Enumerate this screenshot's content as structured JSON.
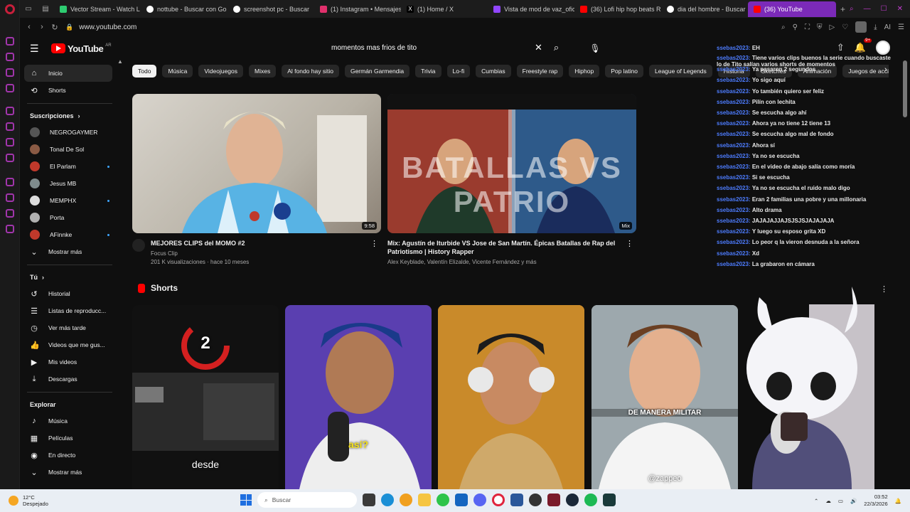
{
  "browser": {
    "tabs": [
      {
        "label": "Vector Stream - Watch L",
        "color": "#2ecc71"
      },
      {
        "label": "nottube - Buscar con Go",
        "color": "#ffffff"
      },
      {
        "label": "screenshot pc - Buscar",
        "color": "#ffffff"
      },
      {
        "label": "(1) Instagram • Mensajes",
        "color": "#e1306c"
      },
      {
        "label": "(1) Home / X",
        "color": "#000000"
      },
      {
        "label": "Vista de mod de vaz_ofic",
        "color": "#9146ff"
      },
      {
        "label": "(36) Lofi hip hop beats R",
        "color": "#ff0000"
      },
      {
        "label": "dia del hombre - Buscar",
        "color": "#ffffff"
      },
      {
        "label": "(36) YouTube",
        "color": "#ff0000"
      }
    ],
    "url": "www.youtube.com",
    "accent": "#7b2ab8"
  },
  "header": {
    "logo_text": "YouTube",
    "logo_region": "AR",
    "search_value": "momentos mas frios de tito",
    "notif_badge": "9+"
  },
  "nav": {
    "main": [
      {
        "label": "Inicio",
        "icon": "home-icon"
      },
      {
        "label": "Shorts",
        "icon": "shorts-icon"
      }
    ],
    "subs_title": "Suscripciones",
    "subs": [
      {
        "label": "NEGROGAYMER",
        "color": "#555555",
        "live": false
      },
      {
        "label": "Tonal De Sol",
        "color": "#8a5a44",
        "live": false
      },
      {
        "label": "El Parlam",
        "color": "#c0392b",
        "live": true
      },
      {
        "label": "Jesus MB",
        "color": "#7f8c8d",
        "live": false
      },
      {
        "label": "MEMPHX",
        "color": "#dddddd",
        "live": true
      },
      {
        "label": "Porta",
        "color": "#b0b0b0",
        "live": false
      },
      {
        "label": "AFinnke",
        "color": "#c0392b",
        "live": true
      }
    ],
    "subs_more": "Mostrar más",
    "you_title": "Tú",
    "you": [
      {
        "label": "Historial",
        "icon": "history-icon"
      },
      {
        "label": "Listas de reproducc...",
        "icon": "playlist-icon"
      },
      {
        "label": "Ver más tarde",
        "icon": "clock-icon"
      },
      {
        "label": "Videos que me gus...",
        "icon": "thumbs-up-icon"
      },
      {
        "label": "Mis videos",
        "icon": "my-videos-icon"
      },
      {
        "label": "Descargas",
        "icon": "download-icon"
      }
    ],
    "explore_title": "Explorar",
    "explore": [
      {
        "label": "Música",
        "icon": "music-icon"
      },
      {
        "label": "Películas",
        "icon": "film-icon"
      },
      {
        "label": "En directo",
        "icon": "live-icon"
      }
    ],
    "explore_more": "Mostrar más"
  },
  "chips": [
    "Todo",
    "Música",
    "Videojuegos",
    "Mixes",
    "Al fondo hay sitio",
    "Germán Garmendia",
    "Trivia",
    "Lo-fi",
    "Cumbias",
    "Freestyle rap",
    "Hiphop",
    "Pop latino",
    "League of Legends",
    "Historia",
    "Sketches",
    "Animación",
    "Juegos de acción y aven"
  ],
  "videos": [
    {
      "title": "MEJORES CLIPS del MOMO #2",
      "channel": "Focus Clip",
      "meta": "201 K visualizaciones · hace 10 meses",
      "duration": "9:58"
    },
    {
      "title": "Mix: Agustín de Iturbide VS Jose de San Martín. Épicas Batallas de Rap del Patriotismo | History Rapper",
      "channel": "Alex Keyblade, Valentín Elizalde, Vicente Fernández y más",
      "meta": "",
      "duration": "Mix",
      "thumb_text": "BATALLAS VS PATRIO"
    }
  ],
  "shorts": {
    "title": "Shorts",
    "items": [
      {
        "caption": "desde",
        "bg": "#111111",
        "extra": "2"
      },
      {
        "caption": "así?",
        "bg": "#5a3fb0"
      },
      {
        "caption": "",
        "bg": "#c98a2a"
      },
      {
        "caption": "DE MANERA MILITAR",
        "bg": "#a9b4b9",
        "extra": "@zappeo"
      }
    ]
  },
  "chat": [
    {
      "user": "ssebas2023:",
      "text": "EH"
    },
    {
      "user": "ssebas2023:",
      "text": "Tiene varios clips buenos la serie cuando buscaste lo de Tito salían varios shorts de momentos"
    },
    {
      "user": "ssebas2023:",
      "text": "Ya pasaron 2 segundos"
    },
    {
      "user": "ssebas2023:",
      "text": "Yo sigo aquí"
    },
    {
      "user": "ssebas2023:",
      "text": "Yo también quiero ser feliz"
    },
    {
      "user": "ssebas2023:",
      "text": "Pilín con lechita"
    },
    {
      "user": "ssebas2023:",
      "text": "Se escucha algo ahí"
    },
    {
      "user": "ssebas2023:",
      "text": "Ahora ya no tiene 12 tiene 13"
    },
    {
      "user": "ssebas2023:",
      "text": "Se escucha algo mal de fondo"
    },
    {
      "user": "ssebas2023:",
      "text": "Ahora sí"
    },
    {
      "user": "ssebas2023:",
      "text": "Ya no se escucha"
    },
    {
      "user": "ssebas2023:",
      "text": "En el video de abajo salía como moría"
    },
    {
      "user": "ssebas2023:",
      "text": "Si se escucha"
    },
    {
      "user": "ssebas2023:",
      "text": "Ya no se escucha el ruido malo digo"
    },
    {
      "user": "ssebas2023:",
      "text": "Eran 2 familias una pobre y una millonaria"
    },
    {
      "user": "ssebas2023:",
      "text": "Alto drama"
    },
    {
      "user": "ssebas2023:",
      "text": "JAJAJAJJAJSJSJSJAJAJAJA"
    },
    {
      "user": "ssebas2023:",
      "text": "Y luego su esposo grita XD"
    },
    {
      "user": "ssebas2023:",
      "text": "Lo peor q la vieron desnuda a la señora"
    },
    {
      "user": "ssebas2023:",
      "text": "Xd"
    },
    {
      "user": "ssebas2023:",
      "text": "La grabaron en cámara"
    }
  ],
  "taskbar": {
    "temp": "12°C",
    "weather": "Despejado",
    "search_placeholder": "Buscar",
    "time": "03:52",
    "date": "22/3/2026"
  }
}
